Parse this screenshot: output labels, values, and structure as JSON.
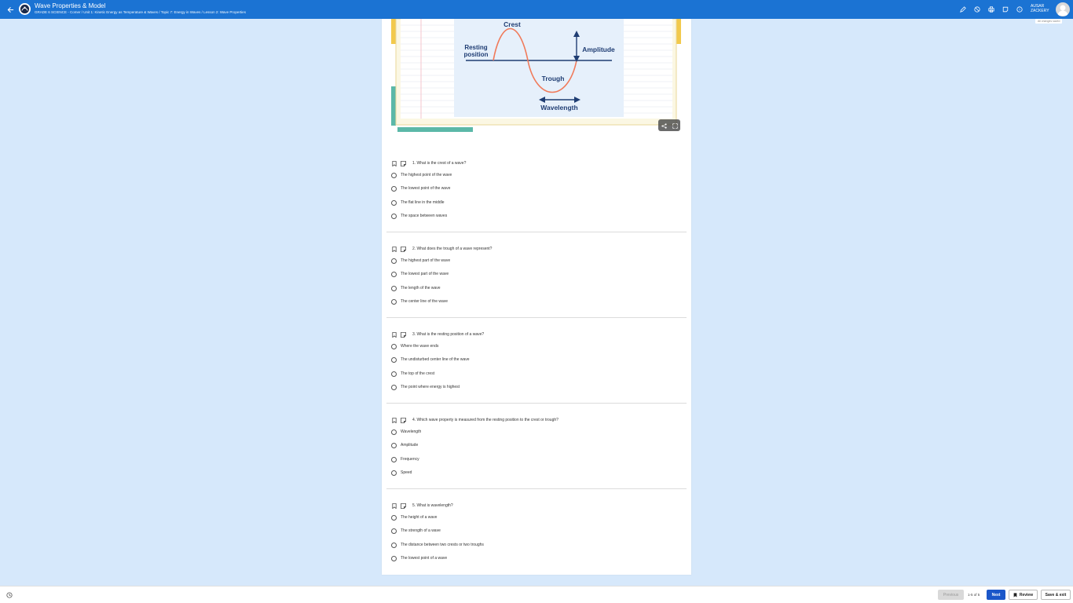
{
  "app": {
    "title": "Wave Properties & Model",
    "breadcrumb": "GRADE 6 SCIENCE - Comer / Unit 1: Kinetic Energy as Temperature & Waves / Topic 7: Energy in Waves / Lesson 2: Wave Properties"
  },
  "user": {
    "first": "AUSAR",
    "last": "ZACKERY",
    "saved_status": "All changes saved"
  },
  "diagram": {
    "crest": "Crest",
    "resting_1": "Resting",
    "resting_2": "position",
    "amplitude": "Amplitude",
    "trough": "Trough",
    "wavelength": "Wavelength"
  },
  "questions": [
    {
      "text": "1. What is the crest of a wave?",
      "options": [
        "The highest point of the wave",
        "The lowest point of the wave",
        "The flat line in the middle",
        "The space between waves"
      ]
    },
    {
      "text": "2. What does the trough of a wave represent?",
      "options": [
        "The highest part of the wave",
        "The lowest part of the wave",
        "The length of the wave",
        "The center line of the wave"
      ]
    },
    {
      "text": "3. What is the resting position of a wave?",
      "options": [
        "Where the wave ends",
        "The undisturbed center line of the wave",
        "The top of the crest",
        "The point where energy is highest"
      ]
    },
    {
      "text": "4. Which wave property is measured from the resting position to the crest or trough?",
      "options": [
        "Wavelength",
        "Amplitude",
        "Frequency",
        "Speed"
      ]
    },
    {
      "text": "5. What is wavelength?",
      "options": [
        "The height of a wave",
        "The strength of a wave",
        "The distance between two crests or two troughs",
        "The lowest point of a wave"
      ]
    }
  ],
  "footer": {
    "previous": "Previous",
    "page_count": "1-5 of 5",
    "next": "Next",
    "review": "Review",
    "save_exit": "Save & exit"
  },
  "colors": {
    "topbar": "#1b73d3",
    "background": "#d6e8fb",
    "next_button": "#1b57c9",
    "wave_curve": "#f07a5a",
    "diagram_ink": "#1f3d73"
  }
}
